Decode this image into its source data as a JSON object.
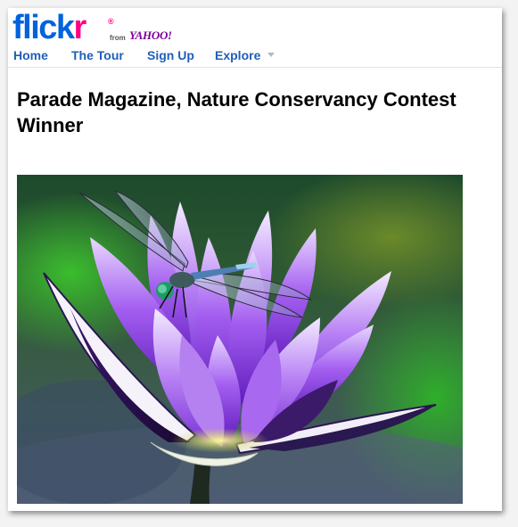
{
  "brand": {
    "logo_part1": "flick",
    "logo_part2": "r",
    "registered": "®",
    "from_text": "from",
    "partner": "YAHOO!",
    "colors": {
      "blue": "#0063dc",
      "pink": "#ff0084",
      "yahoo": "#7b0099"
    }
  },
  "nav": {
    "items": [
      {
        "label": "Home"
      },
      {
        "label": "The Tour"
      },
      {
        "label": "Sign Up"
      },
      {
        "label": "Explore"
      }
    ],
    "explore_menu_icon": "triangle-down-icon"
  },
  "photo": {
    "title": "Parade Magazine, Nature Conservancy Contest Winner",
    "subject": "dragonfly on purple water lily"
  }
}
